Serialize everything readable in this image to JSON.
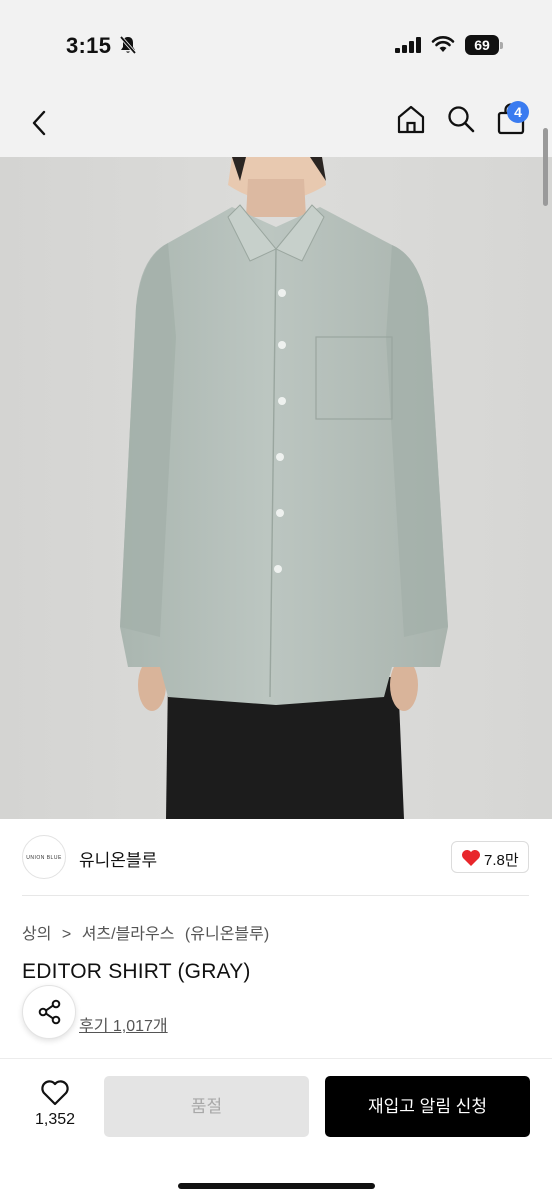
{
  "status": {
    "time": "3:15",
    "battery": "69"
  },
  "nav": {
    "cart_count": "4",
    "icons": [
      "back-icon",
      "home-icon",
      "search-icon",
      "cart-icon"
    ]
  },
  "brand": {
    "logo_text": "UNION BLUE",
    "name": "유니온블루",
    "likes": "7.8만"
  },
  "breadcrumb": {
    "items": [
      "상의",
      ">",
      "셔츠/블라우스",
      "(유니온블루)"
    ]
  },
  "product": {
    "title": "EDITOR SHIRT (GRAY)",
    "review_link": "후기 1,017개"
  },
  "bottom": {
    "wish_count": "1,352",
    "soldout_label": "품절",
    "restock_label": "재입고 알림 신청"
  },
  "colors": {
    "accent_badge": "#3a7bf0",
    "like_heart": "#e8262b",
    "primary_button": "#000000",
    "disabled_button": "#e4e4e4"
  }
}
